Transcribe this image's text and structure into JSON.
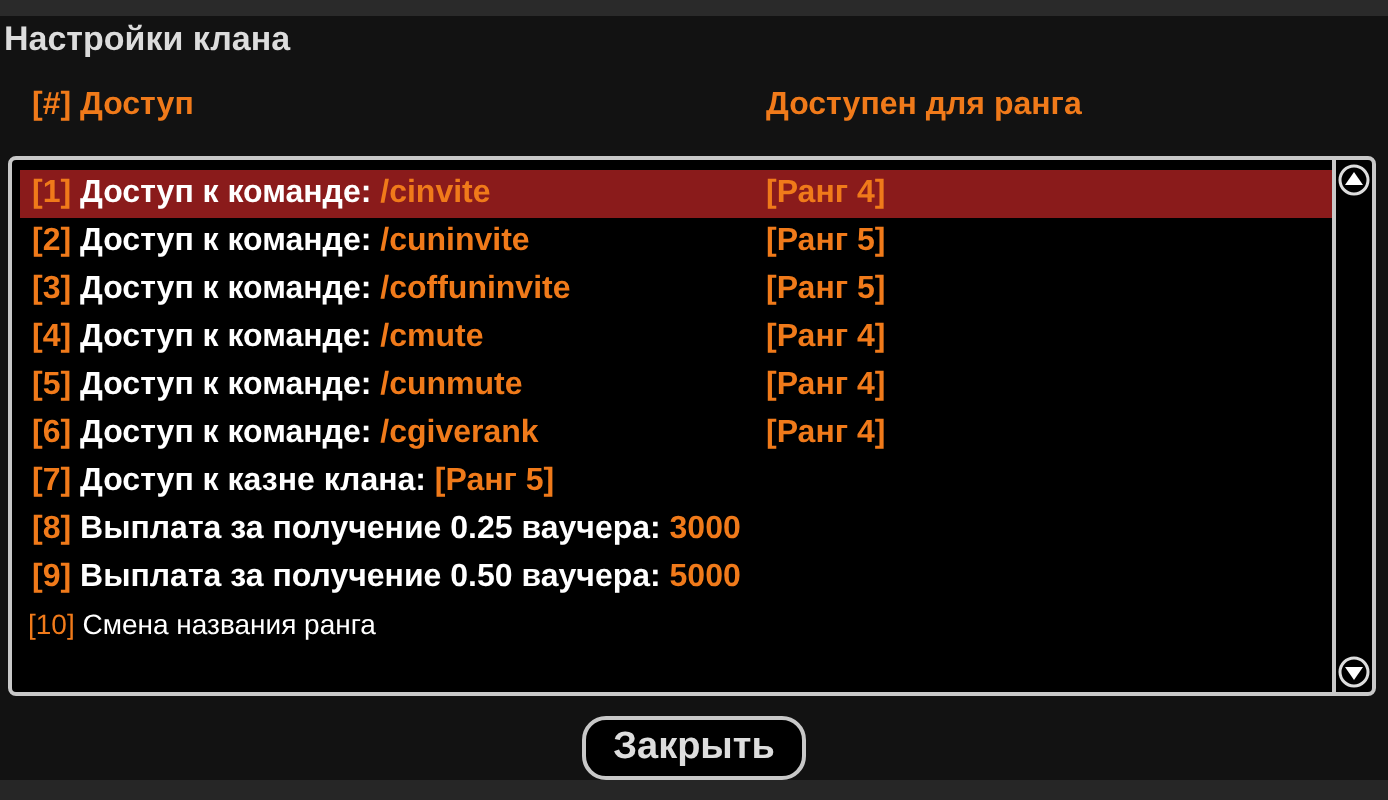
{
  "window": {
    "title": "Настройки клана"
  },
  "columns": [
    "[#] Доступ",
    "Доступен для ранга"
  ],
  "rows": [
    {
      "kind": "command",
      "index": "[1]",
      "label": "Доступ к команде:",
      "value": "/cinvite",
      "rank": "[Ранг 4]",
      "selected": true
    },
    {
      "kind": "command",
      "index": "[2]",
      "label": "Доступ к команде:",
      "value": "/cuninvite",
      "rank": "[Ранг 5]",
      "selected": false
    },
    {
      "kind": "command",
      "index": "[3]",
      "label": "Доступ к команде:",
      "value": "/coffuninvite",
      "rank": "[Ранг 5]",
      "selected": false
    },
    {
      "kind": "command",
      "index": "[4]",
      "label": "Доступ к команде:",
      "value": "/cmute",
      "rank": "[Ранг 4]",
      "selected": false
    },
    {
      "kind": "command",
      "index": "[5]",
      "label": "Доступ к команде:",
      "value": "/cunmute",
      "rank": "[Ранг 4]",
      "selected": false
    },
    {
      "kind": "command",
      "index": "[6]",
      "label": "Доступ к команде:",
      "value": "/cgiverank",
      "rank": "[Ранг 4]",
      "selected": false
    },
    {
      "kind": "setting",
      "index": "[7]",
      "label": "Доступ к казне клана:",
      "value": "[Ранг 5]",
      "selected": false
    },
    {
      "kind": "setting",
      "index": "[8]",
      "label": "Выплата за получение 0.25 ваучера:",
      "value": "3000",
      "selected": false
    },
    {
      "kind": "setting",
      "index": "[9]",
      "label": "Выплата за получение 0.50 ваучера:",
      "value": "5000",
      "selected": false
    },
    {
      "kind": "plain",
      "index": "[10]",
      "label": "Смена названия ранга",
      "selected": false
    }
  ],
  "buttons": [
    "Закрыть"
  ]
}
